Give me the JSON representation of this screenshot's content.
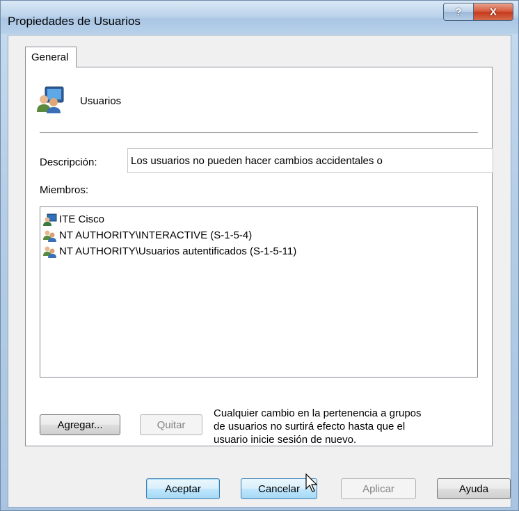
{
  "window": {
    "title": "Propiedades de Usuarios",
    "help_glyph": "?",
    "close_glyph": "X"
  },
  "tabs": [
    {
      "label": "General"
    }
  ],
  "group": {
    "name": "Usuarios",
    "icon": "users-group-icon"
  },
  "description": {
    "label": "Descripción:",
    "value": "Los usuarios no pueden hacer cambios accidentales o"
  },
  "members": {
    "label": "Miembros:",
    "items": [
      {
        "name": "ITE Cisco",
        "icon": "user-icon"
      },
      {
        "name": "NT AUTHORITY\\INTERACTIVE (S-1-5-4)",
        "icon": "group-icon"
      },
      {
        "name": "NT AUTHORITY\\Usuarios autentificados (S-1-5-11)",
        "icon": "group-icon"
      }
    ]
  },
  "buttons": {
    "add": "Agregar...",
    "remove": "Quitar",
    "ok": "Aceptar",
    "cancel": "Cancelar",
    "apply": "Aplicar",
    "help": "Ayuda"
  },
  "note": {
    "line1": "Cualquier cambio en la pertenencia a grupos",
    "line2": "de usuarios no surtirá efecto hasta que el",
    "line3": "usuario inicie sesión de nuevo."
  },
  "colors": {
    "titlebar": "#bdd4ec",
    "close_button": "#c43a1b",
    "dialog_background": "#f0f0f0",
    "default_button_border": "#3c7fb1"
  }
}
